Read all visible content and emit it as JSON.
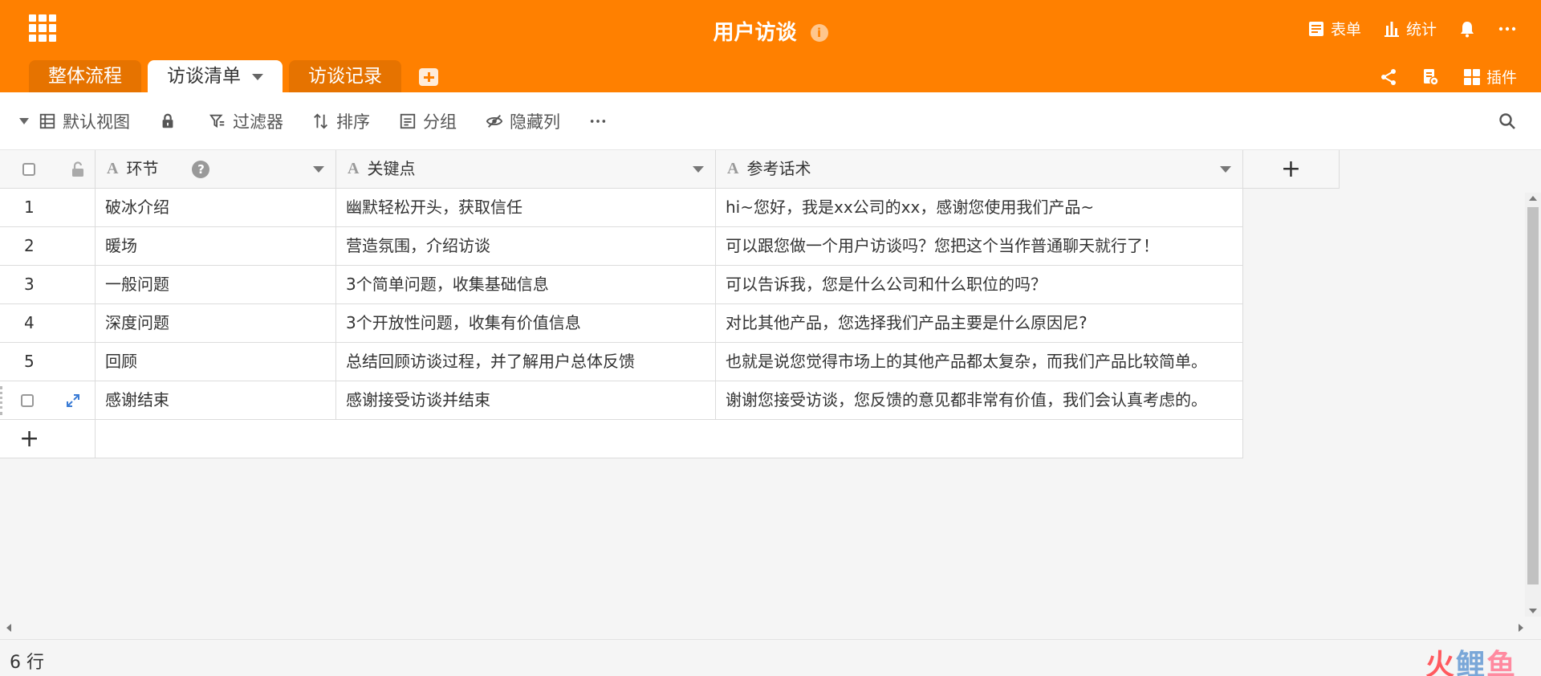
{
  "app": {
    "title": "用户访谈",
    "info_glyph": "i"
  },
  "header": {
    "form_label": "表单",
    "stats_label": "统计",
    "plugins_label": "插件"
  },
  "tabs": [
    {
      "label": "整体流程"
    },
    {
      "label": "访谈清单"
    },
    {
      "label": "访谈记录"
    }
  ],
  "toolbar": {
    "view_label": "默认视图",
    "filter_label": "过滤器",
    "sort_label": "排序",
    "group_label": "分组",
    "hide_label": "隐藏列"
  },
  "table": {
    "columns": [
      {
        "type_glyph": "A",
        "label": "环节"
      },
      {
        "type_glyph": "A",
        "label": "关键点"
      },
      {
        "type_glyph": "A",
        "label": "参考话术"
      }
    ],
    "help_glyph": "?",
    "add_col_glyph": "+",
    "add_row_glyph": "+",
    "rows": [
      {
        "num": "1",
        "stage": "破冰介绍",
        "key": "幽默轻松开头，获取信任",
        "script": "hi~您好，我是xx公司的xx，感谢您使用我们产品~"
      },
      {
        "num": "2",
        "stage": "暖场",
        "key": "营造氛围，介绍访谈",
        "script": "可以跟您做一个用户访谈吗？您把这个当作普通聊天就行了！"
      },
      {
        "num": "3",
        "stage": "一般问题",
        "key": "3个简单问题，收集基础信息",
        "script": "可以告诉我，您是什么公司和什么职位的吗？"
      },
      {
        "num": "4",
        "stage": "深度问题",
        "key": "3个开放性问题，收集有价值信息",
        "script": "对比其他产品，您选择我们产品主要是什么原因尼?"
      },
      {
        "num": "5",
        "stage": "回顾",
        "key": "总结回顾访谈过程，并了解用户总体反馈",
        "script": "也就是说您觉得市场上的其他产品都太复杂，而我们产品比较简单。"
      },
      {
        "num": "",
        "stage": "感谢结束",
        "key": "感谢接受访谈并结束",
        "script": "谢谢您接受访谈，您反馈的意见都非常有价值，我们会认真考虑的。"
      }
    ]
  },
  "footer": {
    "row_count": "6 行",
    "watermark_1": "火",
    "watermark_2": "鲤",
    "watermark_3": "鱼"
  },
  "colors": {
    "brand": "#ff8000",
    "brand_dark": "#e67300"
  }
}
